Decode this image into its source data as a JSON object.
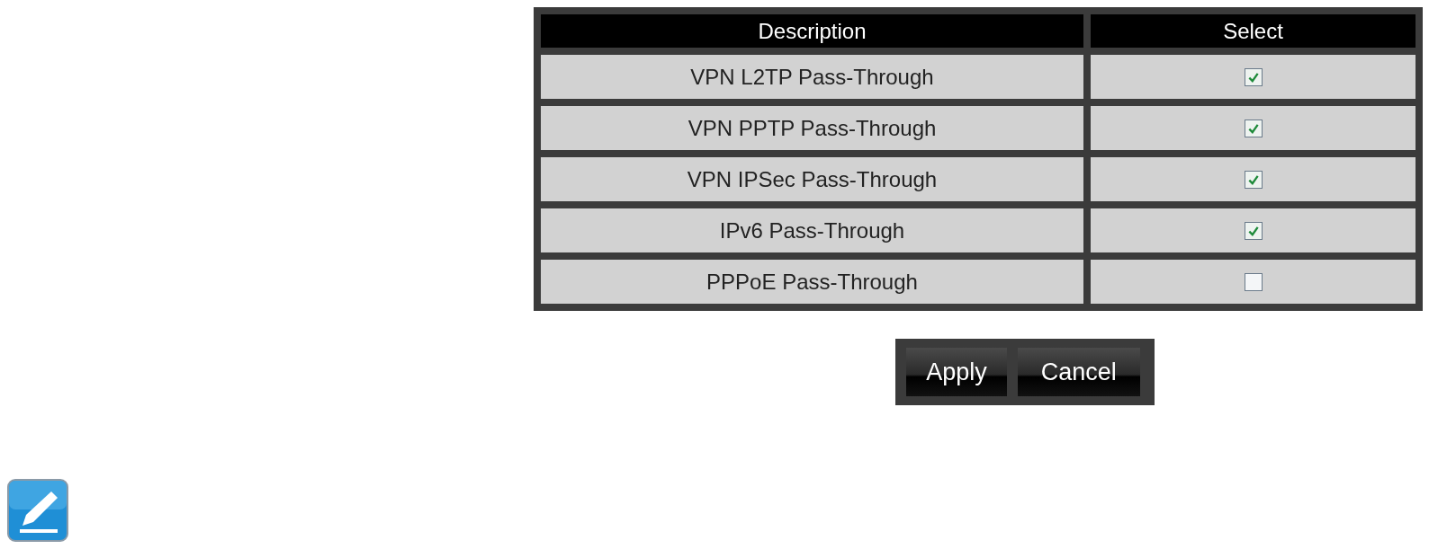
{
  "table": {
    "columns": [
      "Description",
      "Select"
    ],
    "rows": [
      {
        "description": "VPN L2TP Pass-Through",
        "checked": true
      },
      {
        "description": "VPN PPTP Pass-Through",
        "checked": true
      },
      {
        "description": "VPN IPSec Pass-Through",
        "checked": true
      },
      {
        "description": "IPv6 Pass-Through",
        "checked": true
      },
      {
        "description": "PPPoE Pass-Through",
        "checked": false
      }
    ]
  },
  "buttons": [
    "Apply",
    "Cancel"
  ]
}
